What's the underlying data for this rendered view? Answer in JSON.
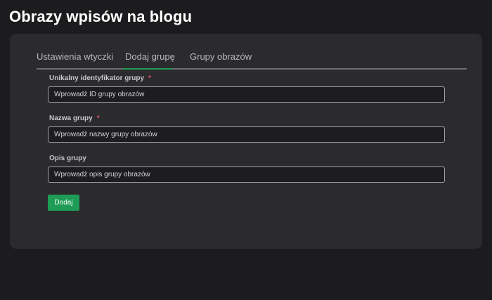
{
  "page": {
    "title": "Obrazy wpisów na blogu"
  },
  "tabs": [
    {
      "label": "Ustawienia wtyczki",
      "active": false
    },
    {
      "label": "Dodaj grupę",
      "active": true
    },
    {
      "label": "Grupy obrazów",
      "active": false
    }
  ],
  "form": {
    "fields": [
      {
        "label": "Unikalny identyfikator grupy",
        "required": true,
        "required_mark": "*",
        "value": "",
        "placeholder": "Wprowadź ID grupy obrazów"
      },
      {
        "label": "Nazwa grupy",
        "required": true,
        "required_mark": "*",
        "value": "",
        "placeholder": "Wprowadź nazwy grupy obrazów"
      },
      {
        "label": "Opis grupy",
        "required": false,
        "required_mark": "",
        "value": "",
        "placeholder": "Wprowadź opis grupy obrazów"
      }
    ],
    "submit_label": "Dodaj"
  },
  "colors": {
    "background": "#1c1c1e",
    "card": "#2b2b2d",
    "accent": "#1e9c55",
    "required": "#e0556b"
  }
}
